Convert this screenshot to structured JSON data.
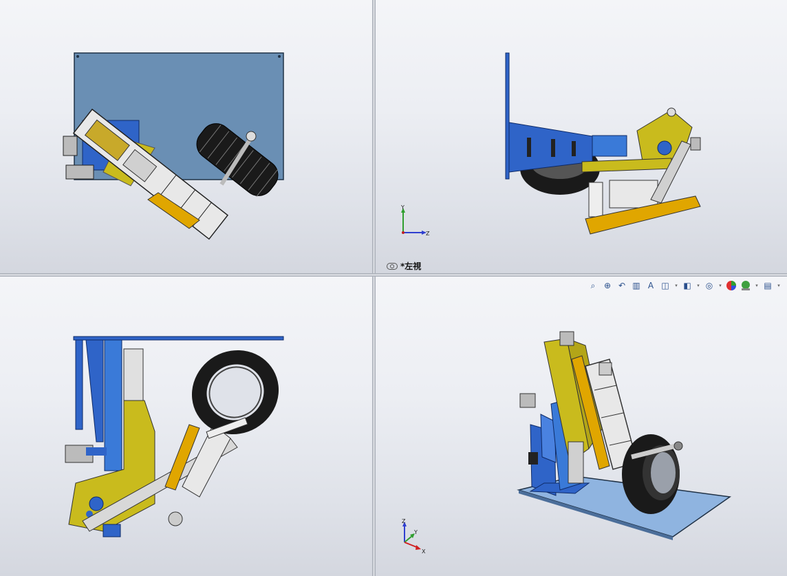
{
  "viewports": {
    "top_left": {
      "name": "front-view-viewport"
    },
    "top_right": {
      "name": "left-view-viewport",
      "label": "*左視"
    },
    "bottom_left": {
      "name": "top-view-viewport"
    },
    "bottom_right": {
      "name": "isometric-view-viewport"
    }
  },
  "triad_top_right": {
    "y": "Y",
    "z": "Z"
  },
  "triad_bottom_right": {
    "z": "Z",
    "y": "Y",
    "x": "X"
  },
  "heads_up_toolbar": [
    {
      "icon": "zoom-to-fit-icon"
    },
    {
      "icon": "zoom-to-area-icon"
    },
    {
      "icon": "previous-view-icon"
    },
    {
      "icon": "section-view-icon"
    },
    {
      "icon": "dynamic-annotation-icon"
    },
    {
      "icon": "view-orientation-icon"
    },
    {
      "icon": "display-style-icon"
    },
    {
      "icon": "hide-show-items-icon"
    },
    {
      "icon": "edit-appearance-icon"
    },
    {
      "icon": "apply-scene-icon"
    },
    {
      "icon": "view-settings-icon"
    }
  ],
  "colors": {
    "plate": "#6a8fb4",
    "blue_part": "#2f64c8",
    "yellow_part": "#c9bb1d",
    "orange_part": "#e0a600",
    "tire": "#1a1a1a",
    "steel": "#d8d8d8"
  }
}
